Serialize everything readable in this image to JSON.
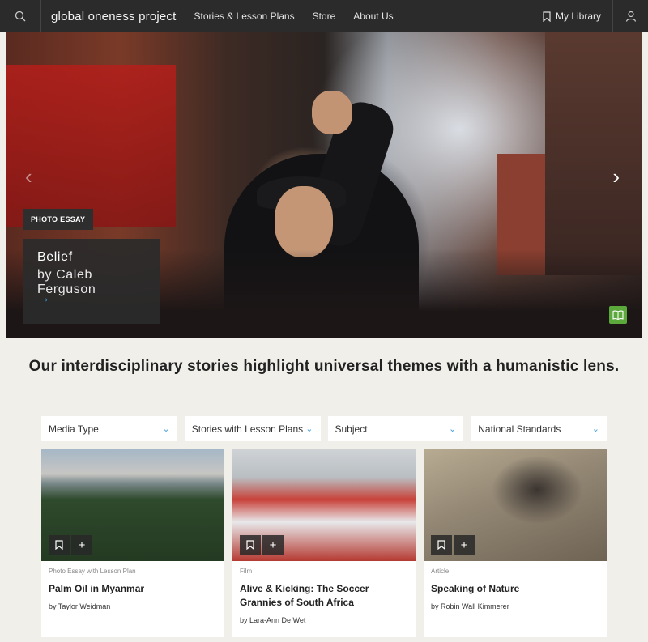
{
  "nav": {
    "brand": "global oneness project",
    "links": [
      "Stories & Lesson Plans",
      "Store",
      "About Us"
    ],
    "library": "My Library",
    "icons": {
      "search": "search-icon",
      "library": "bookmark-icon",
      "account": "user-icon"
    }
  },
  "hero": {
    "badge": "PHOTO ESSAY",
    "title": "Belief",
    "author": "by Caleb Ferguson",
    "go_icon": "→",
    "prev_icon": "‹",
    "next_icon": "›",
    "lesson_icon": "book-icon",
    "accent": "#5ba93b"
  },
  "tagline": "Our interdisciplinary stories highlight universal themes with a humanistic lens.",
  "filters": [
    {
      "label": "Media Type"
    },
    {
      "label": "Stories with Lesson Plans"
    },
    {
      "label": "Subject"
    },
    {
      "label": "National Standards"
    }
  ],
  "cards": [
    {
      "type": "Photo Essay with Lesson Plan",
      "title": "Palm Oil in Myanmar",
      "by": "by Taylor Weidman"
    },
    {
      "type": "Film",
      "title": "Alive & Kicking: The Soccer Grannies of South Africa",
      "by": "by Lara-Ann De Wet"
    },
    {
      "type": "Article",
      "title": "Speaking of Nature",
      "by": "by Robin Wall Kimmerer"
    }
  ],
  "colors": {
    "nav_bg": "#2b2b2b",
    "page_bg": "#f0efea",
    "link_blue": "#3ca0e0"
  }
}
